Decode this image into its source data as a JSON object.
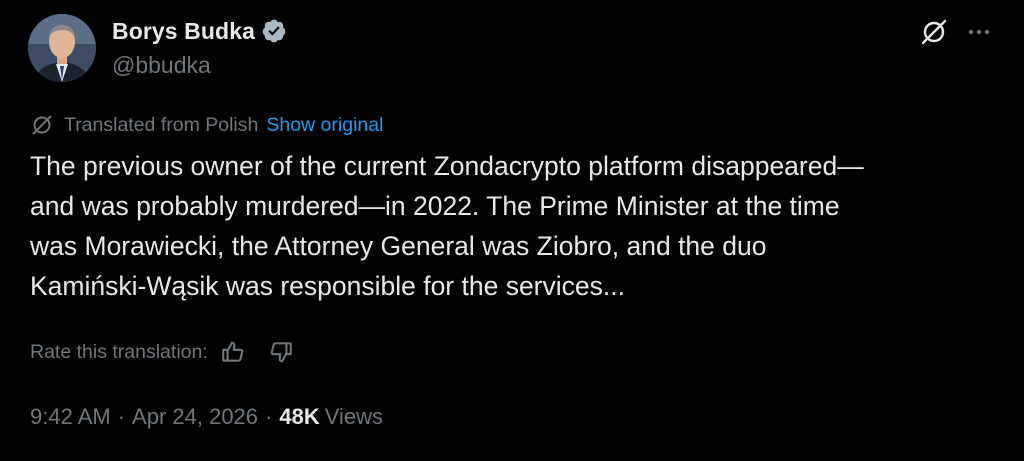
{
  "author": {
    "display_name": "Borys Budka",
    "handle": "@bbudka",
    "verified": true
  },
  "translation": {
    "label": "Translated from Polish",
    "show_original": "Show original"
  },
  "text": "The previous owner of the current Zondacrypto platform disappeared—\nand was probably murdered—in 2022. The Prime Minister at the time\nwas Morawiecki, the Attorney General was Ziobro, and the duo\nKamiński-Wąsik was responsible for the services...",
  "rate": {
    "label": "Rate this translation:"
  },
  "meta": {
    "time": "9:42 AM",
    "separator": "·",
    "date": "Apr 24, 2026",
    "views_count": "48K",
    "views_label": "Views"
  },
  "icons": {
    "verified": "verified-badge-icon",
    "grok": "grok-icon",
    "more": "more-icon",
    "translate": "translate-icon",
    "thumbs_up": "thumbs-up-icon",
    "thumbs_down": "thumbs-down-icon"
  },
  "colors": {
    "background": "#000000",
    "text": "#e7e9ea",
    "secondary": "#71767b",
    "accent": "#1d9bf0"
  }
}
